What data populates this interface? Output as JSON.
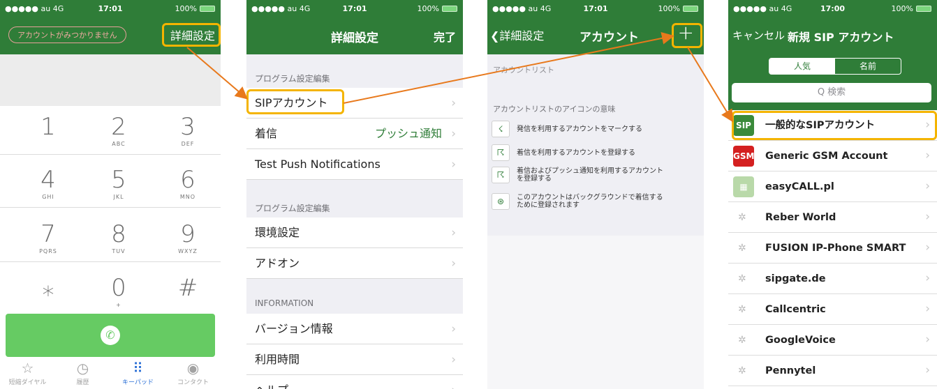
{
  "colors": {
    "nav": "#2f7d38",
    "highlight": "#f4b400",
    "arrow": "#e8791c",
    "call": "#66cb63"
  },
  "status": {
    "carrier": "●●●●● au  4G",
    "battery": "100%",
    "time_a": "17:01",
    "time_b": "17:00"
  },
  "p1": {
    "account_pill": "アカウントがみつかりません",
    "nav_right": "詳細設定",
    "keys": [
      {
        "d": "1",
        "l": ""
      },
      {
        "d": "2",
        "l": "ABC"
      },
      {
        "d": "3",
        "l": "DEF"
      },
      {
        "d": "4",
        "l": "GHI"
      },
      {
        "d": "5",
        "l": "JKL"
      },
      {
        "d": "6",
        "l": "MNO"
      },
      {
        "d": "7",
        "l": "PQRS"
      },
      {
        "d": "8",
        "l": "TUV"
      },
      {
        "d": "9",
        "l": "WXYZ"
      },
      {
        "d": "⁎",
        "l": ""
      },
      {
        "d": "0",
        "l": "+"
      },
      {
        "d": "#",
        "l": ""
      }
    ],
    "tabs": [
      {
        "icon": "☆",
        "label": "短縮ダイヤル"
      },
      {
        "icon": "◷",
        "label": "履歴"
      },
      {
        "icon": "⠿",
        "label": "キーパッド"
      },
      {
        "icon": "◉",
        "label": "コンタクト"
      }
    ]
  },
  "p2": {
    "title": "詳細設定",
    "done": "完了",
    "sec1": "プログラム設定編集",
    "sip": "SIPアカウント",
    "incoming": "着信",
    "incoming_value": "プッシュ通知",
    "test_push": "Test Push Notifications",
    "sec2": "プログラム設定編集",
    "env": "環境設定",
    "addon": "アドオン",
    "sec3": "INFORMATION",
    "version": "バージョン情報",
    "usage": "利用時間",
    "help": "ヘルプ"
  },
  "p3": {
    "back": "詳細設定",
    "title": "アカウント",
    "plus": "+",
    "list_header": "アカウントリスト",
    "icons_header": "アカウントリストのアイコンの意味",
    "items": [
      {
        "icon": "☇",
        "text": "発信を利用するアカウントをマークする"
      },
      {
        "icon": "☈",
        "text": "着信を利用するアカウントを登録する"
      },
      {
        "icon": "☈",
        "text": "着信およびプッシュ通知を利用するアカウント\nを登録する"
      },
      {
        "icon": "⊛",
        "text": "このアカウントはバックグラウンドで着信する\nために登録されます"
      }
    ]
  },
  "p4": {
    "cancel": "キャンセル",
    "title": "新規 SIP アカウント",
    "seg_popular": "人気",
    "seg_name": "名前",
    "search": "Q 検索",
    "providers": [
      {
        "name": "一般的なSIPアカウント",
        "logo": "SIP",
        "color": "#3a8a3a"
      },
      {
        "name": "Generic GSM Account",
        "logo": "GSM",
        "color": "#d42020"
      },
      {
        "name": "easyCALL.pl",
        "logo": "▦",
        "color": "#b9d9a9"
      },
      {
        "name": "Reber World",
        "logo": "",
        "color": ""
      },
      {
        "name": "FUSION IP-Phone SMART",
        "logo": "",
        "color": ""
      },
      {
        "name": "sipgate.de",
        "logo": "",
        "color": ""
      },
      {
        "name": "Callcentric",
        "logo": "",
        "color": ""
      },
      {
        "name": "GoogleVoice",
        "logo": "",
        "color": ""
      },
      {
        "name": "Pennytel",
        "logo": "",
        "color": ""
      }
    ]
  }
}
